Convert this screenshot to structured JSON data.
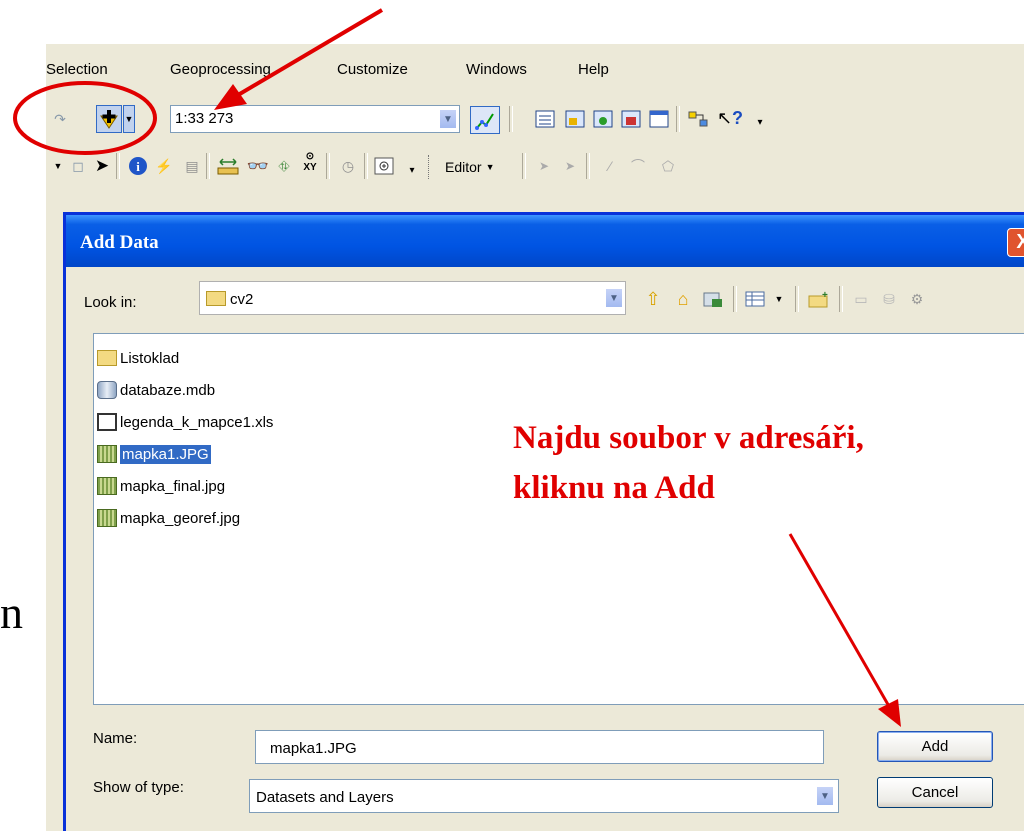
{
  "menubar": {
    "items": [
      "Selection",
      "Geoprocessing",
      "Customize",
      "Windows",
      "Help"
    ]
  },
  "toolbar": {
    "scale_value": "1:33 273",
    "help_glyph": "?",
    "editor_label": "Editor"
  },
  "dialog": {
    "title": "Add Data",
    "close_glyph": "X",
    "look_in_label": "Look in:",
    "look_in_value": "cv2",
    "files": [
      {
        "name": "Listoklad",
        "icon": "folder-icon"
      },
      {
        "name": "databaze.mdb",
        "icon": "database-icon"
      },
      {
        "name": "legenda_k_mapce1.xls",
        "icon": "table-icon"
      },
      {
        "name": "mapka1.JPG",
        "icon": "raster-icon",
        "selected": true
      },
      {
        "name": "mapka_final.jpg",
        "icon": "raster-icon"
      },
      {
        "name": "mapka_georef.jpg",
        "icon": "raster-icon"
      }
    ],
    "name_label": "Name:",
    "name_value": "mapka1.JPG",
    "type_label": "Show of type:",
    "type_value": "Datasets and Layers",
    "add_label": "Add",
    "cancel_label": "Cancel"
  },
  "annotation": {
    "line1": "Najdu soubor v adresáři,",
    "line2": "kliknu na Add",
    "color": "#e00000"
  },
  "background_glyph": "n"
}
